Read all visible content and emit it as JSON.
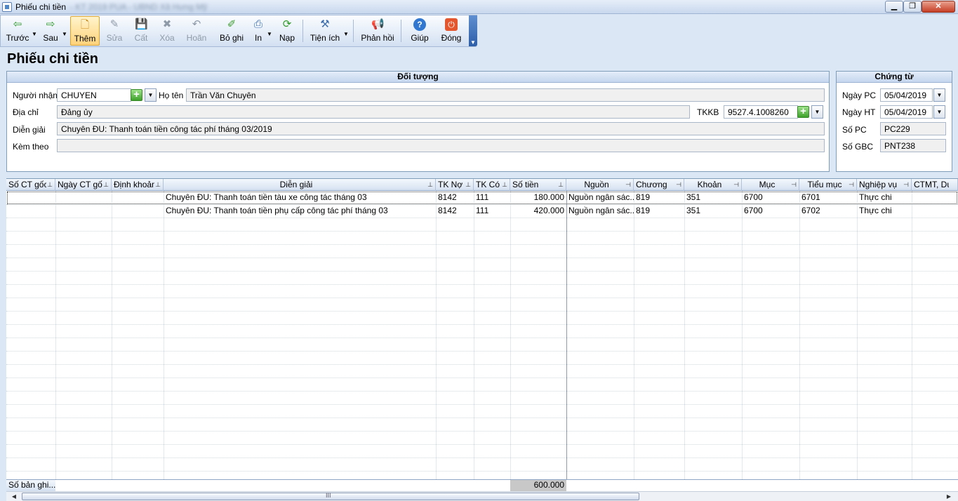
{
  "window": {
    "title": "Phiếu chi tiền",
    "subtitle": "- KT 2019 PUA - UBND Xã Hưng Mỹ",
    "controls": {
      "minimize": "▁",
      "maximize": "❐",
      "close": "✕"
    }
  },
  "toolbar": {
    "items": [
      {
        "label": "Trước",
        "icon": "arrow-left-icon",
        "glyph": "⇦"
      },
      {
        "label": "Sau",
        "icon": "arrow-right-icon",
        "glyph": "⇨"
      },
      {
        "label": "Thêm",
        "icon": "add-document-icon",
        "glyph": "🗋"
      },
      {
        "label": "Sửa",
        "icon": "edit-icon",
        "glyph": "✎"
      },
      {
        "label": "Cất",
        "icon": "save-icon",
        "glyph": "💾"
      },
      {
        "label": "Xóa",
        "icon": "delete-icon",
        "glyph": "✖"
      },
      {
        "label": "Hoãn",
        "icon": "undo-icon",
        "glyph": "↶"
      },
      {
        "label": "Bỏ ghi",
        "icon": "unpost-icon",
        "glyph": "✐"
      },
      {
        "label": "In",
        "icon": "print-icon",
        "glyph": "⎙"
      },
      {
        "label": "Nạp",
        "icon": "refresh-icon",
        "glyph": "⟳"
      },
      {
        "label": "Tiện ích",
        "icon": "tools-icon",
        "glyph": "⚒"
      },
      {
        "label": "Phản hồi",
        "icon": "feedback-icon",
        "glyph": "📢"
      },
      {
        "label": "Giúp",
        "icon": "help-icon",
        "glyph": "?"
      },
      {
        "label": "Đóng",
        "icon": "close-power-icon",
        "glyph": "⏻"
      }
    ],
    "colors": {
      "active_bg": "#ffd27a",
      "disabled_text": "#8f9aa8"
    }
  },
  "page_title": "Phiếu chi tiền",
  "doi_tuong": {
    "heading": "Đối tượng",
    "nguoi_nhan_label": "Người nhận",
    "nguoi_nhan_value": "CHUYEN",
    "ho_ten_label": "Họ tên",
    "ho_ten_value": "Trần Văn Chuyên",
    "dia_chi_label": "Địa chỉ",
    "dia_chi_value": "Đảng ủy",
    "tkkb_label": "TKKB",
    "tkkb_value": "9527.4.1008260",
    "dien_giai_label": "Diễn giải",
    "dien_giai_value": "Chuyên ĐU: Thanh toán tiền công tác phí tháng 03/2019",
    "kem_theo_label": "Kèm theo",
    "kem_theo_value": ""
  },
  "chung_tu": {
    "heading": "Chứng từ",
    "ngay_pc_label": "Ngày PC",
    "ngay_pc_value": "05/04/2019",
    "ngay_ht_label": "Ngày HT",
    "ngay_ht_value": "05/04/2019",
    "so_pc_label": "Số PC",
    "so_pc_value": "PC229",
    "so_gbc_label": "Số GBC",
    "so_gbc_value": "PNT238"
  },
  "grid": {
    "columns": [
      "Số CT gốc",
      "Ngày CT gốc",
      "Định khoản",
      "Diễn giải",
      "TK Nợ",
      "TK Có",
      "Số tiền",
      "Nguồn",
      "Chương",
      "Khoản",
      "Mục",
      "Tiểu mục",
      "Nghiệp vụ",
      "CTMT, Dự"
    ],
    "rows": [
      [
        "",
        "",
        "",
        "Chuyên ĐU: Thanh toán tiền tàu xe công tác tháng 03",
        "8142",
        "111",
        "180.000",
        "Nguồn ngân sác...",
        "819",
        "351",
        "6700",
        "6701",
        "Thực chi",
        ""
      ],
      [
        "",
        "",
        "",
        "Chuyên ĐU: Thanh toán tiền phụ cấp công tác phí tháng 03",
        "8142",
        "111",
        "420.000",
        "Nguồn ngân sác...",
        "819",
        "351",
        "6700",
        "6702",
        "Thực chi",
        ""
      ]
    ],
    "footer_label": "Số bản ghi...",
    "footer_total": "600.000",
    "scroll_grip": "III"
  }
}
